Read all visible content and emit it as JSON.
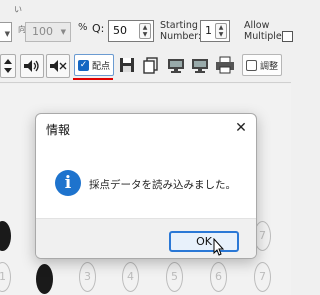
{
  "toolbar_top": {
    "small_label_1": "い",
    "small_label_2": "向",
    "zoom_value": "100",
    "percent_sign": "%",
    "q_label": "Q:",
    "q_value": "50",
    "starting_label_line1": "Starting",
    "starting_label_line2": "Number:",
    "starting_value": "1",
    "allow_label_line1": "Allow",
    "allow_label_line2": "Multiple :"
  },
  "toolbar_bottom": {
    "haiten_label": "配点",
    "adjust_label": "調整",
    "icons": [
      "spin-icon",
      "sound-on-icon",
      "sound-mute-icon",
      "save-icon",
      "copy-icon",
      "monitor-icon",
      "monitor-icon",
      "printer-icon"
    ]
  },
  "sheet": {
    "row1": [
      "",
      "",
      "",
      "",
      "",
      "",
      "",
      "",
      "7"
    ],
    "row2": [
      "1",
      "",
      "3",
      "4",
      "5",
      "6",
      "",
      "",
      "7"
    ]
  },
  "dialog": {
    "title": "情報",
    "close_glyph": "✕",
    "icon_glyph": "i",
    "message": "採点データを読み込みました。",
    "ok_label": "OK"
  },
  "colors": {
    "accent": "#2a78d6",
    "info_icon": "#1e73cd",
    "red_underline": "#e00000"
  }
}
